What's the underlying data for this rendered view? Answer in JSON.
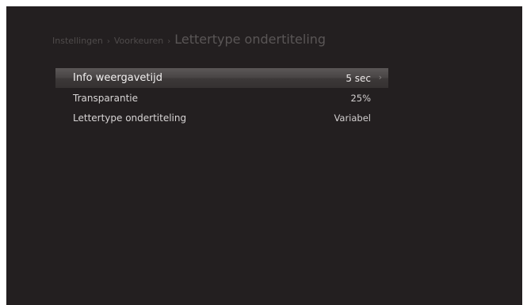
{
  "breadcrumb": {
    "level1": "Instellingen",
    "level2": "Voorkeuren",
    "separator": "›",
    "title": "Lettertype ondertiteling"
  },
  "menu": {
    "items": [
      {
        "label": "Info weergavetijd",
        "value": "5 sec",
        "selected": true
      },
      {
        "label": "Transparantie",
        "value": "25%",
        "selected": false
      },
      {
        "label": "Lettertype ondertiteling",
        "value": "Variabel",
        "selected": false
      }
    ],
    "chevron": "›"
  },
  "colors": {
    "background": "#231f20",
    "highlight": "#4a4646",
    "text": "#d8d5d5"
  }
}
